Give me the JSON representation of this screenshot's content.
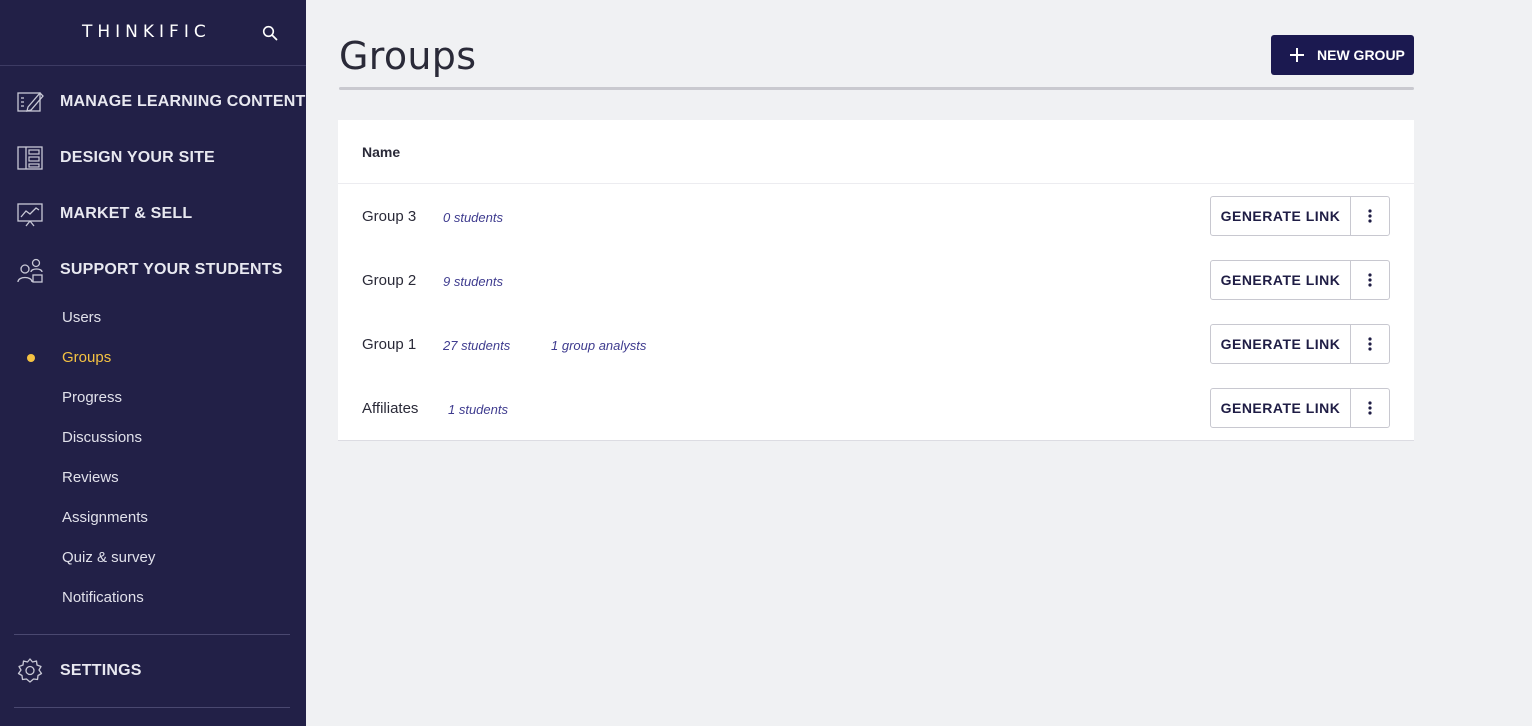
{
  "brand": "THINKIFIC",
  "sidebar": {
    "main_nav": [
      {
        "label": "MANAGE LEARNING CONTENT",
        "icon": "edit-content-icon"
      },
      {
        "label": "DESIGN YOUR SITE",
        "icon": "layout-icon"
      },
      {
        "label": "MARKET & SELL",
        "icon": "chart-presentation-icon"
      },
      {
        "label": "SUPPORT YOUR STUDENTS",
        "icon": "people-icon"
      }
    ],
    "sub_nav": [
      {
        "label": "Users",
        "active": false
      },
      {
        "label": "Groups",
        "active": true
      },
      {
        "label": "Progress",
        "active": false
      },
      {
        "label": "Discussions",
        "active": false
      },
      {
        "label": "Reviews",
        "active": false
      },
      {
        "label": "Assignments",
        "active": false
      },
      {
        "label": "Quiz & survey",
        "active": false
      },
      {
        "label": "Notifications",
        "active": false
      }
    ],
    "settings": {
      "label": "SETTINGS",
      "icon": "gear-icon"
    }
  },
  "page": {
    "title": "Groups",
    "new_group_label": "NEW GROUP"
  },
  "table": {
    "column_header": "Name",
    "generate_label": "GENERATE LINK",
    "rows": [
      {
        "name": "Group 3",
        "students": "0 students",
        "analysts": ""
      },
      {
        "name": "Group 2",
        "students": "9 students",
        "analysts": ""
      },
      {
        "name": "Group 1",
        "students": "27 students",
        "analysts": "1 group analysts"
      },
      {
        "name": "Affiliates",
        "students": "1 students",
        "analysts": ""
      }
    ]
  },
  "colors": {
    "sidebar_bg": "#222047",
    "accent": "#f5c242",
    "primary_button": "#1b1950",
    "link": "#3f3c8f"
  }
}
